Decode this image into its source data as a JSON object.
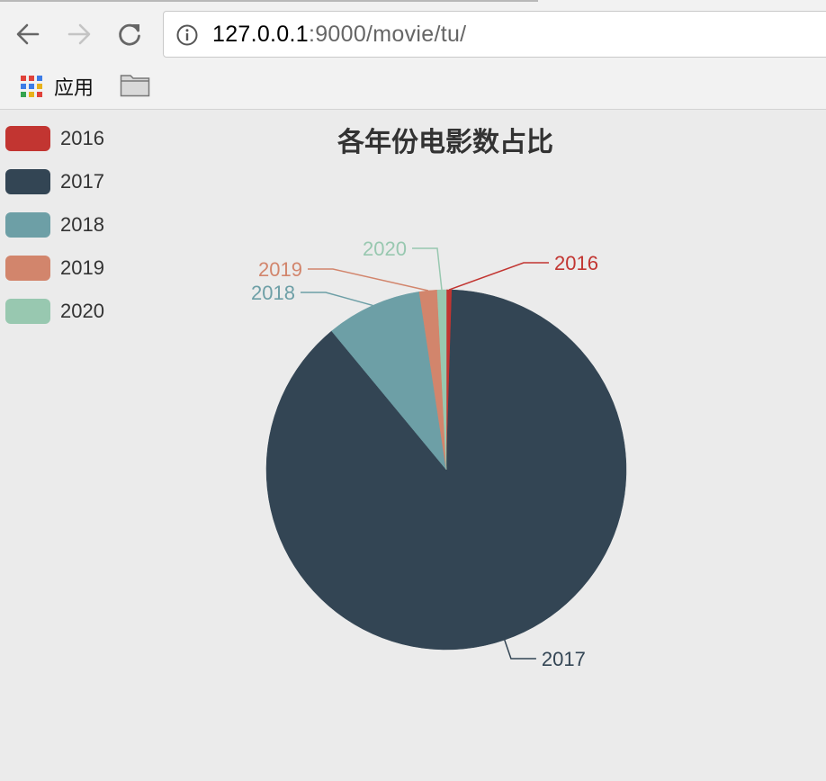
{
  "browser": {
    "url_host": "127.0.0.1",
    "url_rest": ":9000/movie/tu/",
    "bookmarks": {
      "apps_label": "应用"
    },
    "icons": [
      "back-icon",
      "forward-icon",
      "reload-icon",
      "info-icon",
      "apps-icon",
      "folder-icon"
    ]
  },
  "chart_data": {
    "type": "pie",
    "title": "各年份电影数占比",
    "legend_position": "top-left",
    "categories": [
      "2016",
      "2017",
      "2018",
      "2019",
      "2020"
    ],
    "values": [
      0.5,
      88.5,
      8.6,
      1.6,
      0.8
    ],
    "colors": [
      "#c23531",
      "#334554",
      "#6d9fa6",
      "#d2856c",
      "#98c8b0"
    ]
  }
}
